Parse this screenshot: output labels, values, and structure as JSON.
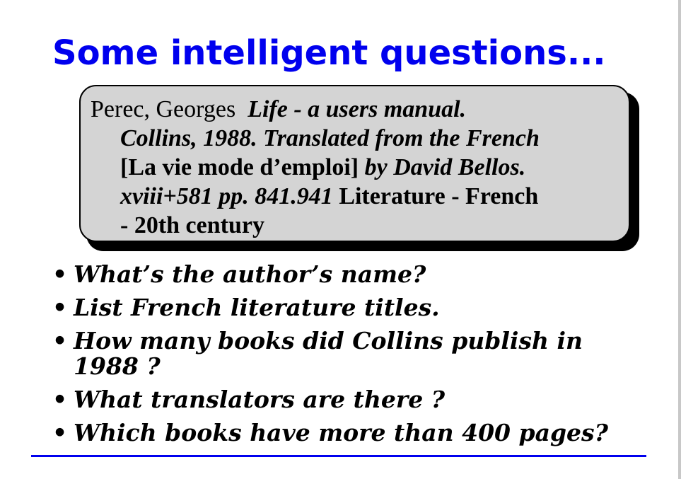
{
  "slide": {
    "title": "Some intelligent questions..."
  },
  "citation": {
    "author": "Perec, Georges",
    "title": "Life - a users manual.",
    "publisher_line": "Collins, 1988. Translated from the French",
    "original_title": "[La vie mode d’emploi]",
    "translator": "by David Bellos.",
    "pages": "xviii+581 pp. 841.941",
    "subject_1": "Literature - French",
    "subject_2": "- 20th century"
  },
  "questions": [
    {
      "bullet": "•",
      "line1": "What’s the author’s name?",
      "line2": ""
    },
    {
      "bullet": "•",
      "line1": "List French literature titles.",
      "line2": ""
    },
    {
      "bullet": "•",
      "line1": "How many books did Collins publish in",
      "line2": "1988 ?"
    },
    {
      "bullet": "•",
      "line1": "What translators are there ?",
      "line2": ""
    },
    {
      "bullet": "•",
      "line1": "Which books have more than 400 pages?",
      "line2": ""
    }
  ],
  "colors": {
    "title": "#0000ee",
    "box_fill": "#d4d4d4",
    "rule": "#0000ee"
  }
}
